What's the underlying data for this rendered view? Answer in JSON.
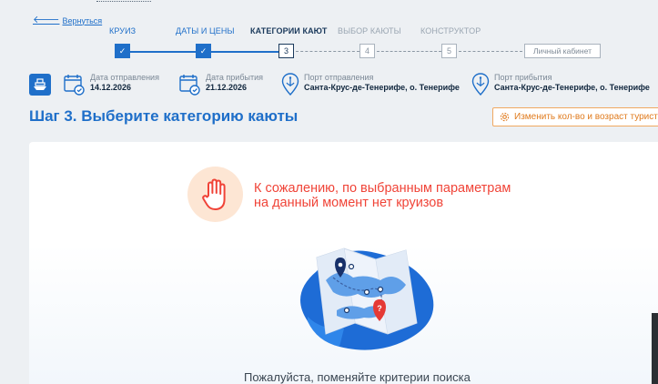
{
  "nav": {
    "back_label": "Вернуться"
  },
  "steps": [
    {
      "label": "КРУИЗ",
      "marker": "✓",
      "state": "done"
    },
    {
      "label": "ДАТЫ И ЦЕНЫ",
      "marker": "✓",
      "state": "done"
    },
    {
      "label": "КАТЕГОРИИ КАЮТ",
      "marker": "3",
      "state": "active"
    },
    {
      "label": "ВЫБОР КАЮТЫ",
      "marker": "4",
      "state": "future"
    },
    {
      "label": "КОНСТРУКТОР",
      "marker": "5",
      "state": "future"
    }
  ],
  "cabinet_label": "Личный кабинет",
  "info": {
    "departure_date": {
      "label": "Дата отправления",
      "value": "14.12.2026"
    },
    "arrival_date": {
      "label": "Дата прибытия",
      "value": "21.12.2026"
    },
    "departure_port": {
      "label": "Порт отправления",
      "value": "Санта-Крус-де-Тенерифе, о. Тенерифе"
    },
    "arrival_port": {
      "label": "Порт прибытия",
      "value": "Санта-Крус-де-Тенерифе, о. Тенерифе"
    }
  },
  "page_title": "Шаг 3.  Выберите категорию каюты",
  "change_button_label": "Изменить кол-во и возраст туристов",
  "empty_state": {
    "line1": "К сожалению, по выбранным параметрам",
    "line2": "на данный момент нет круизов",
    "hint": "Пожалуйста, поменяйте критерии поиска"
  },
  "colors": {
    "accent": "#1f6fc9",
    "error": "#f04438",
    "warning": "#e07b1e",
    "hand_bg": "#fde6d4"
  },
  "icons": [
    "back-arrow-icon",
    "check-icon",
    "ship-icon",
    "calendar-icon",
    "anchor-pin-icon",
    "settings-gear-icon",
    "stop-hand-icon",
    "map-illustration"
  ]
}
